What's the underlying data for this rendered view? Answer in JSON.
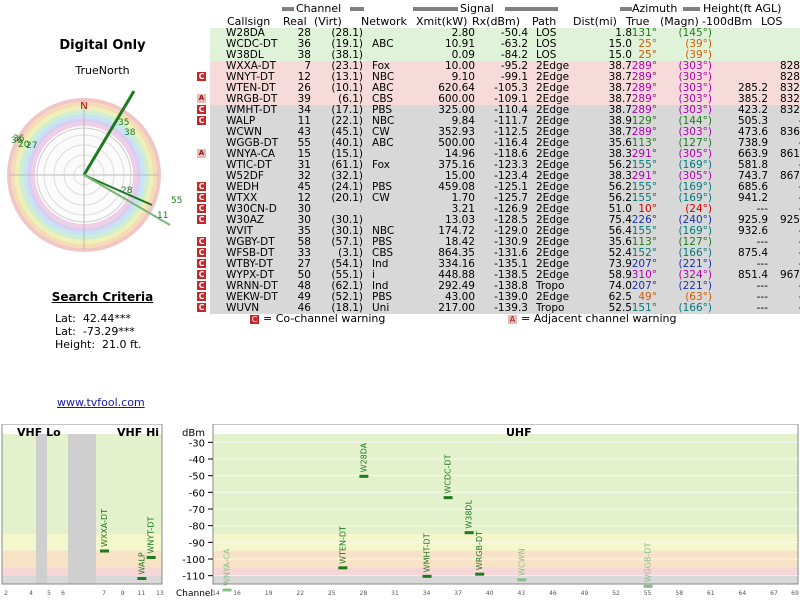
{
  "left": {
    "title": "Digital Only",
    "compass_label": "TrueNorth",
    "compass_n": "N",
    "search_title": "Search Criteria",
    "lat": "Lat:  42.44***",
    "lon": "Lat:  -73.29***",
    "height": "Height:  21.0 ft.",
    "link": "www.tvfool.com",
    "polar_labels": [
      "38",
      "35",
      "36",
      "28",
      "55",
      "11",
      "36",
      "20",
      "27"
    ]
  },
  "table": {
    "group_headers": {
      "channel": "Channel",
      "signal": "Signal",
      "azimuth": "Azimuth",
      "height": "Height(ft AGL)"
    },
    "columns": [
      "Callsign",
      "Real",
      "(Virt)",
      "Network",
      "Xmit(kW)",
      "Rx(dBm)",
      "Path",
      "Dist(mi)",
      "True",
      "(Magn)",
      "-100dBm",
      "LOS"
    ],
    "rows": [
      {
        "warn": "",
        "call": "W28DA",
        "real": "28",
        "virt": "(28.1)",
        "net": "",
        "kw": "2.80",
        "rx": "-50.4",
        "path": "LOS",
        "dist": "1.8",
        "true": "131°",
        "magn": "(145°)",
        "h100": "",
        "los": "",
        "tier": "green",
        "az": "green"
      },
      {
        "warn": "",
        "call": "WCDC-DT",
        "real": "36",
        "virt": "(19.1)",
        "net": "ABC",
        "kw": "10.91",
        "rx": "-63.2",
        "path": "LOS",
        "dist": "15.0",
        "true": "25°",
        "magn": "(39°)",
        "h100": "",
        "los": "",
        "tier": "green",
        "az": "orange"
      },
      {
        "warn": "",
        "call": "W38DL",
        "real": "38",
        "virt": "(38.1)",
        "net": "",
        "kw": "0.09",
        "rx": "-84.2",
        "path": "LOS",
        "dist": "15.0",
        "true": "25°",
        "magn": "(39°)",
        "h100": "",
        "los": "",
        "tier": "green",
        "az": "orange"
      },
      {
        "warn": "",
        "call": "WXXA-DT",
        "real": "7",
        "virt": "(23.1)",
        "net": "Fox",
        "kw": "10.00",
        "rx": "-95.2",
        "path": "2Edge",
        "dist": "38.7",
        "true": "289°",
        "magn": "(303°)",
        "h100": "",
        "los": "828.8",
        "tier": "pink",
        "az": "magenta"
      },
      {
        "warn": "co",
        "call": "WNYT-DT",
        "real": "12",
        "virt": "(13.1)",
        "net": "NBC",
        "kw": "9.10",
        "rx": "-99.1",
        "path": "2Edge",
        "dist": "38.7",
        "true": "289°",
        "magn": "(303°)",
        "h100": "",
        "los": "828.8",
        "tier": "pink",
        "az": "magenta"
      },
      {
        "warn": "",
        "call": "WTEN-DT",
        "real": "26",
        "virt": "(10.1)",
        "net": "ABC",
        "kw": "620.64",
        "rx": "-105.3",
        "path": "2Edge",
        "dist": "38.7",
        "true": "289°",
        "magn": "(303°)",
        "h100": "285.2",
        "los": "832.1",
        "tier": "pink",
        "az": "magenta"
      },
      {
        "warn": "adj",
        "call": "WRGB-DT",
        "real": "39",
        "virt": "(6.1)",
        "net": "CBS",
        "kw": "600.00",
        "rx": "-109.1",
        "path": "2Edge",
        "dist": "38.7",
        "true": "289°",
        "magn": "(303°)",
        "h100": "385.2",
        "los": "832.1",
        "tier": "pink",
        "az": "magenta"
      },
      {
        "warn": "co",
        "call": "WMHT-DT",
        "real": "34",
        "virt": "(17.1)",
        "net": "PBS",
        "kw": "325.00",
        "rx": "-110.4",
        "path": "2Edge",
        "dist": "38.7",
        "true": "289°",
        "magn": "(303°)",
        "h100": "423.2",
        "los": "832.1",
        "tier": "gray",
        "az": "magenta"
      },
      {
        "warn": "co",
        "call": "WALP",
        "real": "11",
        "virt": "(22.1)",
        "net": "NBC",
        "kw": "9.84",
        "rx": "-111.7",
        "path": "2Edge",
        "dist": "38.9",
        "true": "129°",
        "magn": "(144°)",
        "h100": "505.3",
        "los": "---",
        "tier": "gray",
        "az": "green"
      },
      {
        "warn": "",
        "call": "WCWN",
        "real": "43",
        "virt": "(45.1)",
        "net": "CW",
        "kw": "352.93",
        "rx": "-112.5",
        "path": "2Edge",
        "dist": "38.7",
        "true": "289°",
        "magn": "(303°)",
        "h100": "473.6",
        "los": "836.5",
        "tier": "gray",
        "az": "magenta"
      },
      {
        "warn": "",
        "call": "WGGB-DT",
        "real": "55",
        "virt": "(40.1)",
        "net": "ABC",
        "kw": "500.00",
        "rx": "-116.4",
        "path": "2Edge",
        "dist": "35.6",
        "true": "113°",
        "magn": "(127°)",
        "h100": "738.9",
        "los": "---",
        "tier": "gray",
        "az": "green"
      },
      {
        "warn": "adj",
        "call": "WNYA-CA",
        "real": "15",
        "virt": "(15.1)",
        "net": "",
        "kw": "14.96",
        "rx": "-118.6",
        "path": "2Edge",
        "dist": "38.3",
        "true": "291°",
        "magn": "(305°)",
        "h100": "663.9",
        "los": "861.9",
        "tier": "gray",
        "az": "magenta"
      },
      {
        "warn": "",
        "call": "WTIC-DT",
        "real": "31",
        "virt": "(61.1)",
        "net": "Fox",
        "kw": "375.16",
        "rx": "-123.3",
        "path": "2Edge",
        "dist": "56.2",
        "true": "155°",
        "magn": "(169°)",
        "h100": "581.8",
        "los": "---",
        "tier": "gray",
        "az": "teal"
      },
      {
        "warn": "",
        "call": "W52DF",
        "real": "32",
        "virt": "(32.1)",
        "net": "",
        "kw": "15.00",
        "rx": "-123.4",
        "path": "2Edge",
        "dist": "38.3",
        "true": "291°",
        "magn": "(305°)",
        "h100": "743.7",
        "los": "867.2",
        "tier": "gray",
        "az": "magenta"
      },
      {
        "warn": "co",
        "call": "WEDH",
        "real": "45",
        "virt": "(24.1)",
        "net": "PBS",
        "kw": "459.08",
        "rx": "-125.1",
        "path": "2Edge",
        "dist": "56.2",
        "true": "155°",
        "magn": "(169°)",
        "h100": "685.6",
        "los": "---",
        "tier": "gray",
        "az": "teal"
      },
      {
        "warn": "co",
        "call": "WTXX",
        "real": "12",
        "virt": "(20.1)",
        "net": "CW",
        "kw": "1.70",
        "rx": "-125.7",
        "path": "2Edge",
        "dist": "56.2",
        "true": "155°",
        "magn": "(169°)",
        "h100": "941.2",
        "los": "---",
        "tier": "gray",
        "az": "teal"
      },
      {
        "warn": "co",
        "call": "W30CN-D",
        "real": "30",
        "virt": "",
        "net": "",
        "kw": "3.21",
        "rx": "-126.9",
        "path": "2Edge",
        "dist": "51.0",
        "true": "10°",
        "magn": "(24°)",
        "h100": "---",
        "los": "---",
        "tier": "gray",
        "az": "red"
      },
      {
        "warn": "co",
        "call": "W30AZ",
        "real": "30",
        "virt": "(30.1)",
        "net": "",
        "kw": "13.03",
        "rx": "-128.5",
        "path": "2Edge",
        "dist": "75.4",
        "true": "226°",
        "magn": "(240°)",
        "h100": "925.9",
        "los": "925.9",
        "tier": "gray",
        "az": "blue"
      },
      {
        "warn": "",
        "call": "WVIT",
        "real": "35",
        "virt": "(30.1)",
        "net": "NBC",
        "kw": "174.72",
        "rx": "-129.0",
        "path": "2Edge",
        "dist": "56.4",
        "true": "155°",
        "magn": "(169°)",
        "h100": "932.6",
        "los": "---",
        "tier": "gray",
        "az": "teal"
      },
      {
        "warn": "co",
        "call": "WGBY-DT",
        "real": "58",
        "virt": "(57.1)",
        "net": "PBS",
        "kw": "18.42",
        "rx": "-130.9",
        "path": "2Edge",
        "dist": "35.6",
        "true": "113°",
        "magn": "(127°)",
        "h100": "---",
        "los": "---",
        "tier": "gray",
        "az": "green"
      },
      {
        "warn": "co",
        "call": "WFSB-DT",
        "real": "33",
        "virt": "(3.1)",
        "net": "CBS",
        "kw": "864.35",
        "rx": "-131.6",
        "path": "2Edge",
        "dist": "52.4",
        "true": "152°",
        "magn": "(166°)",
        "h100": "875.4",
        "los": "---",
        "tier": "gray",
        "az": "teal"
      },
      {
        "warn": "co",
        "call": "WTBY-DT",
        "real": "27",
        "virt": "(54.1)",
        "net": "Ind",
        "kw": "334.16",
        "rx": "-135.1",
        "path": "2Edge",
        "dist": "73.9",
        "true": "207°",
        "magn": "(221°)",
        "h100": "---",
        "los": "---",
        "tier": "gray",
        "az": "blue"
      },
      {
        "warn": "co",
        "call": "WYPX-DT",
        "real": "50",
        "virt": "(55.1)",
        "net": "i",
        "kw": "448.88",
        "rx": "-138.5",
        "path": "2Edge",
        "dist": "58.9",
        "true": "310°",
        "magn": "(324°)",
        "h100": "851.4",
        "los": "967.7",
        "tier": "gray",
        "az": "magenta"
      },
      {
        "warn": "co",
        "call": "WRNN-DT",
        "real": "48",
        "virt": "(62.1)",
        "net": "Ind",
        "kw": "292.49",
        "rx": "-138.8",
        "path": "Tropo",
        "dist": "74.0",
        "true": "207°",
        "magn": "(221°)",
        "h100": "---",
        "los": "---",
        "tier": "gray",
        "az": "blue"
      },
      {
        "warn": "co",
        "call": "WEKW-DT",
        "real": "49",
        "virt": "(52.1)",
        "net": "PBS",
        "kw": "43.00",
        "rx": "-139.0",
        "path": "2Edge",
        "dist": "62.5",
        "true": "49°",
        "magn": "(63°)",
        "h100": "---",
        "los": "---",
        "tier": "gray",
        "az": "orange"
      },
      {
        "warn": "co",
        "call": "WUVN",
        "real": "46",
        "virt": "(18.1)",
        "net": "Uni",
        "kw": "217.00",
        "rx": "-139.3",
        "path": "Tropo",
        "dist": "52.5",
        "true": "151°",
        "magn": "(166°)",
        "h100": "---",
        "los": "---",
        "tier": "gray",
        "az": "teal"
      }
    ]
  },
  "legend": {
    "co_glyph": "C",
    "co_text": "= Co-channel warning",
    "adj_glyph": "A",
    "adj_text": "= Adjacent channel warning"
  },
  "chart_data": {
    "type": "bar",
    "panels": [
      "VHF Lo",
      "VHF Hi",
      "UHF"
    ],
    "y_unit": "dBm",
    "y_ticks": [
      -30,
      -40,
      -50,
      -60,
      -70,
      -80,
      -90,
      -100,
      -110
    ],
    "ylim": [
      -115,
      -25
    ],
    "xlabel": "Channel",
    "vhf_lo_ticks": [
      "2",
      "4",
      "5",
      "6"
    ],
    "vhf_hi_ticks": [
      "7",
      "9",
      "11",
      "13"
    ],
    "uhf_ticks": [
      "14",
      "16",
      "19",
      "22",
      "25",
      "28",
      "31",
      "34",
      "37",
      "40",
      "43",
      "46",
      "49",
      "52",
      "55",
      "58",
      "61",
      "64",
      "67",
      "69"
    ],
    "stations": [
      {
        "call": "WXXA-DT",
        "channel": 7,
        "rx": -95.2,
        "band": "hi"
      },
      {
        "call": "WNYT-DT",
        "channel": 12,
        "rx": -99.1,
        "band": "hi"
      },
      {
        "call": "WALP",
        "channel": 11,
        "rx": -111.7,
        "band": "hi"
      },
      {
        "call": "W28DA",
        "channel": 28,
        "rx": -50.4,
        "band": "uhf"
      },
      {
        "call": "WCDC-DT",
        "channel": 36,
        "rx": -63.2,
        "band": "uhf"
      },
      {
        "call": "W38DL",
        "channel": 38,
        "rx": -84.2,
        "band": "uhf"
      },
      {
        "call": "WTEN-DT",
        "channel": 26,
        "rx": -105.3,
        "band": "uhf"
      },
      {
        "call": "WRGB-DT",
        "channel": 39,
        "rx": -109.1,
        "band": "uhf"
      },
      {
        "call": "WMHT-DT",
        "channel": 34,
        "rx": -110.4,
        "band": "uhf"
      },
      {
        "call": "WCWN",
        "channel": 43,
        "rx": -112.5,
        "band": "uhf"
      },
      {
        "call": "WGGB-DT",
        "channel": 55,
        "rx": -116.4,
        "band": "uhf"
      },
      {
        "call": "WNYA-CA",
        "channel": 15,
        "rx": -118.6,
        "band": "uhf"
      }
    ]
  }
}
